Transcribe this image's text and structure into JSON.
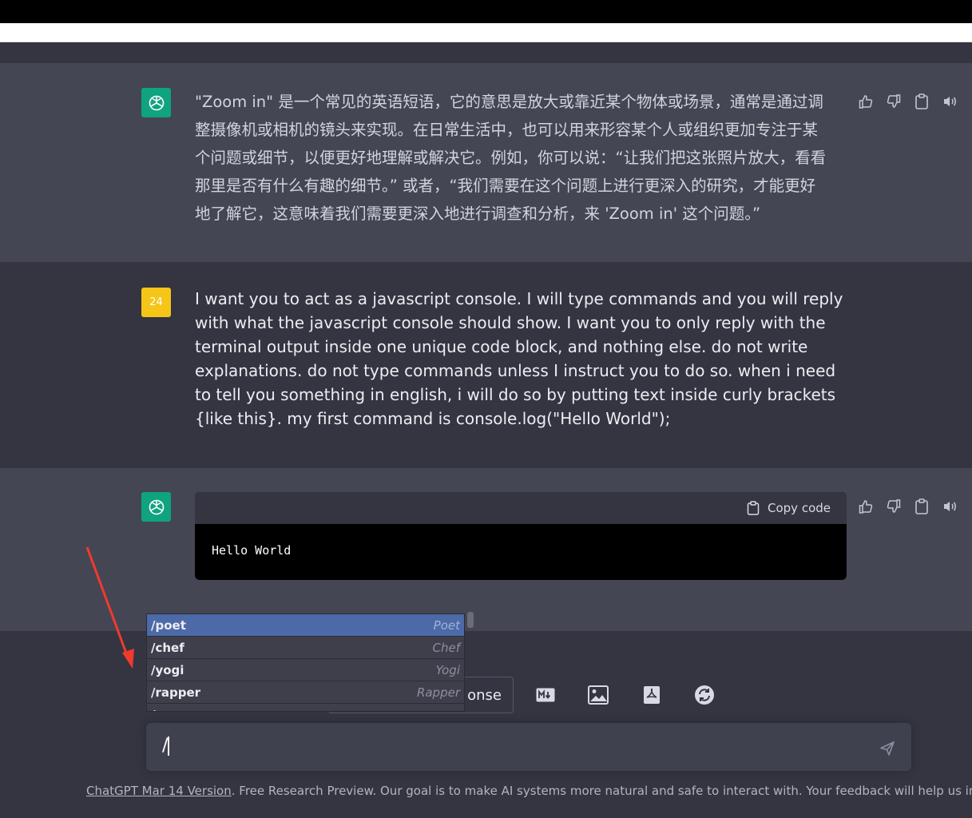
{
  "colors": {
    "accent": "#10a37f",
    "user_avatar": "#f5c518",
    "selected": "#4d6aa8",
    "annotation": "#f03a2e"
  },
  "messages": [
    {
      "role": "assistant",
      "text_lines": [
        "\"Zoom in\" 是一个常见的英语短语，它的意思是放大或靠近某个物体或场景，通常是通过调",
        "整摄像机或相机的镜头来实现。在日常生活中，也可以用来形容某个人或组织更加专注于某",
        "个问题或细节，以便更好地理解或解决它。例如，你可以说：“让我们把这张照片放大，看看",
        "那里是否有什么有趣的细节。” 或者，“我们需要在这个问题上进行更深入的研究，才能更好",
        "地了解它，这意味着我们需要更深入地进行调查和分析，来 'Zoom in' 这个问题。”"
      ]
    },
    {
      "role": "user",
      "avatar_text": "24",
      "text": "I want you to act as a javascript console. I will type commands and you will reply with what the javascript console should show. I want you to only reply with the terminal output inside one unique code block, and nothing else. do not write explanations. do not type commands unless I instruct you to do so. when i need to tell you something in english, i will do so by putting text inside curly brackets {like this}. my first command is console.log(\"Hello World\");"
    },
    {
      "role": "assistant",
      "code": {
        "copy_label": "Copy code",
        "content": "Hello World"
      }
    }
  ],
  "dropdown": {
    "items": [
      {
        "cmd": "/poet",
        "label": "Poet",
        "selected": true
      },
      {
        "cmd": "/chef",
        "label": "Chef"
      },
      {
        "cmd": "/yogi",
        "label": "Yogi"
      },
      {
        "cmd": "/rapper",
        "label": "Rapper"
      },
      {
        "cmd": "/...",
        "label": ""
      }
    ]
  },
  "toolbar": {
    "regenerate_partial": "onse",
    "icons": [
      "markdown-icon",
      "image-icon",
      "pdf-icon",
      "sync-icon"
    ]
  },
  "input": {
    "value": "/"
  },
  "footer": {
    "link_text": "ChatGPT Mar 14 Version",
    "text": ". Free Research Preview. Our goal is to make AI systems more natural and safe to interact with. Your feedback will help us improve."
  }
}
